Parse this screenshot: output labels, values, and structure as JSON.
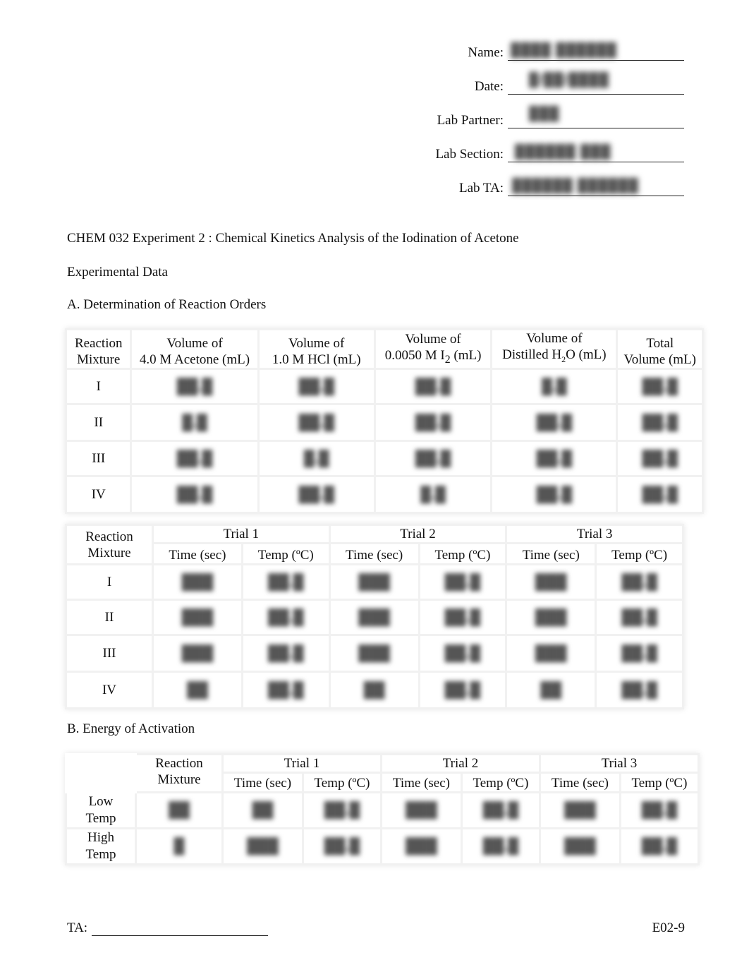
{
  "header_fields": [
    {
      "label": "Name:",
      "value_redacted": "████ ██████"
    },
    {
      "label": "Date:",
      "value_redacted": "█/██/████"
    },
    {
      "label": "Lab Partner:",
      "value_redacted": "███"
    },
    {
      "label": "Lab Section:",
      "value_redacted": "██████ ███"
    },
    {
      "label": "Lab TA:",
      "value_redacted": "██████ ██████"
    }
  ],
  "title": "CHEM 032 Experiment 2  : Chemical Kinetics Analysis of the Iodination of Acetone",
  "experimental_data_heading": "Experimental Data",
  "section_a": {
    "heading": "A. Determination of Reaction Orders",
    "volume_table": {
      "headers": [
        {
          "line1": "Reaction",
          "line2": "Mixture"
        },
        {
          "line1": "Volume of",
          "line2": "4.0 M Acetone (mL)"
        },
        {
          "line1": "Volume of",
          "line2": "1.0 M HCl (mL)"
        },
        {
          "line1": "Volume of",
          "line2_pre": "0.0050 M  I",
          "line2_sub": "2",
          "line2_post": " (mL)"
        },
        {
          "line1": "Volume of",
          "line2_pre": "Distilled H",
          "line2_sub": "2",
          "line2_post": "O (mL)"
        },
        {
          "line1": "Total",
          "line2": "Volume (mL)"
        }
      ],
      "rows": [
        {
          "mixture": "I",
          "cells": [
            "██.█",
            "██.█",
            "██.█",
            "█.█",
            "██.█"
          ]
        },
        {
          "mixture": "II",
          "cells": [
            "█.█",
            "██.█",
            "██.█",
            "██.█",
            "██.█"
          ]
        },
        {
          "mixture": "III",
          "cells": [
            "██.█",
            "█.█",
            "██.█",
            "██.█",
            "██.█"
          ]
        },
        {
          "mixture": "IV",
          "cells": [
            "██.█",
            "██.█",
            "█.█",
            "██.█",
            "██.█"
          ]
        }
      ]
    },
    "trial_table": {
      "mixture_header": {
        "line1": "Reaction",
        "line2": "Mixture"
      },
      "trials": [
        "Trial 1",
        "Trial 2",
        "Trial 3"
      ],
      "sub_headers": [
        "Time (sec)",
        "Temp (ºC)"
      ],
      "rows": [
        {
          "mixture": "I",
          "cells": [
            "███",
            "██.█",
            "███",
            "██.█",
            "███",
            "██.█"
          ]
        },
        {
          "mixture": "II",
          "cells": [
            "███",
            "██.█",
            "███",
            "██.█",
            "███",
            "██.█"
          ]
        },
        {
          "mixture": "III",
          "cells": [
            "███",
            "██.█",
            "███",
            "██.█",
            "███",
            "██.█"
          ]
        },
        {
          "mixture": "IV",
          "cells": [
            "██",
            "██.█",
            "██",
            "██.█",
            "██",
            "██.█"
          ]
        }
      ]
    }
  },
  "section_b": {
    "heading": "B. Energy of Activation",
    "table": {
      "mixture_header": {
        "line1": "Reaction",
        "line2": "Mixture"
      },
      "trials": [
        "Trial 1",
        "Trial 2",
        "Trial 3"
      ],
      "sub_headers": [
        "Time (sec)",
        "Temp (ºC)"
      ],
      "rows": [
        {
          "label_line1": "Low",
          "label_line2": "Temp",
          "mixture": "██",
          "cells": [
            "██",
            "██.█",
            "███",
            "██.█",
            "███",
            "██.█"
          ]
        },
        {
          "label_line1": "High",
          "label_line2": "Temp",
          "mixture": "█",
          "cells": [
            "███",
            "██.█",
            "███",
            "██.█",
            "███",
            "██.█"
          ]
        }
      ]
    }
  },
  "footer": {
    "ta_label": "TA:",
    "page_code": "E02-9"
  }
}
